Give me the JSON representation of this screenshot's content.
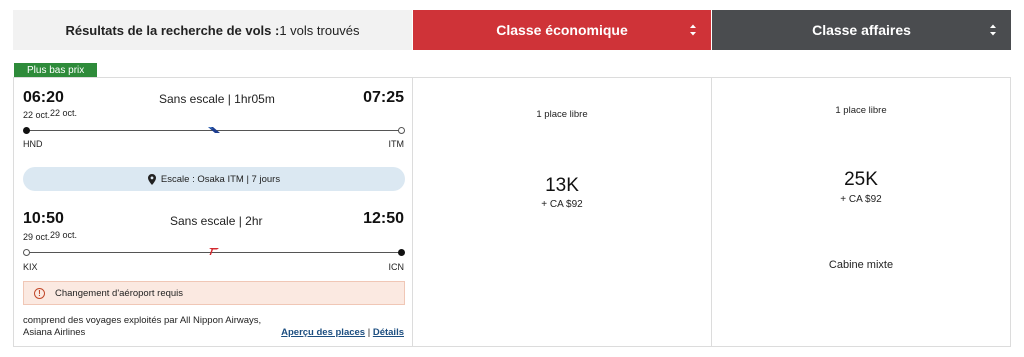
{
  "header": {
    "results_bold": "Résultats de la recherche de vols :",
    "results_count": "1 vols trouvés",
    "economy_label": "Classe économique",
    "business_label": "Classe affaires",
    "colors": {
      "economy": "#cf3338",
      "business": "#4a4c4f",
      "flag": "#2e8b3a"
    }
  },
  "badge": {
    "label": "Plus bas prix"
  },
  "segments": [
    {
      "dep_time": "06:20",
      "arr_time": "07:25",
      "summary": "Sans escale | 1hr05m",
      "date_a": "22 oct.",
      "date_b": "22 oct.",
      "origin": "HND",
      "destination": "ITM",
      "airline_icon": "ana-logo-icon"
    },
    {
      "dep_time": "10:50",
      "arr_time": "12:50",
      "summary": "Sans escale | 2hr",
      "date_a": "29 oct.",
      "date_b": "29 oct.",
      "origin": "KIX",
      "destination": "ICN",
      "airline_icon": "asiana-logo-icon"
    }
  ],
  "stopover": {
    "text": "Escale : Osaka ITM | 7 jours"
  },
  "warning": {
    "text": "Changement d'aéroport requis"
  },
  "operated_by": "comprend des voyages exploités par All Nippon Airways, Asiana Airlines",
  "links": {
    "seats_preview": "Aperçu des places",
    "separator": "|",
    "details": "Détails"
  },
  "economy": {
    "seats": "1 place libre",
    "price": "13K",
    "tax": "+ CA $92"
  },
  "business": {
    "seats": "1 place libre",
    "price": "25K",
    "tax": "+ CA $92",
    "cabin": "Cabine mixte"
  }
}
